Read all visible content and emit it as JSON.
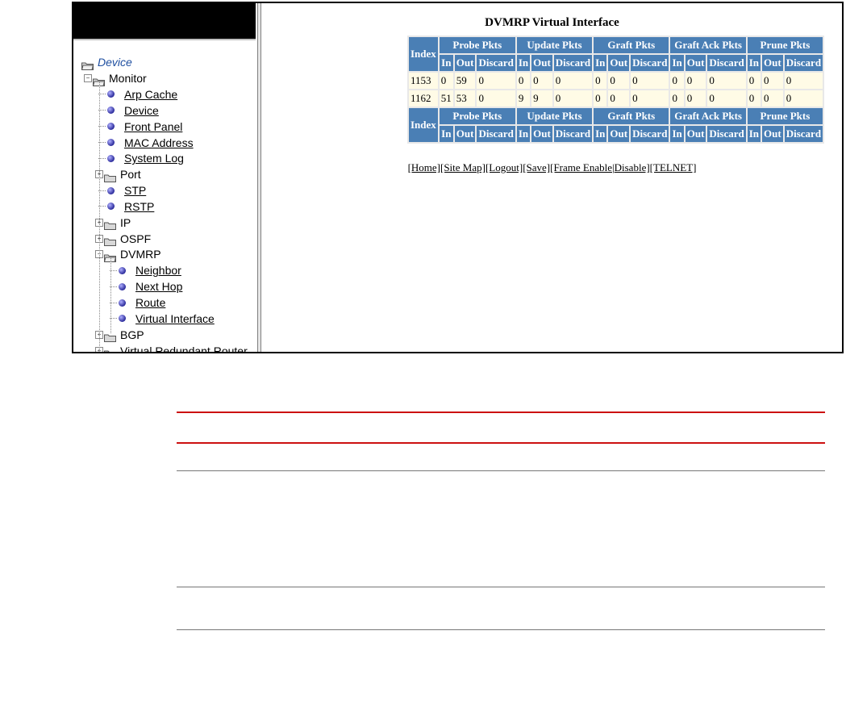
{
  "tree": {
    "device": "Device",
    "monitor": "Monitor",
    "monitor_items": [
      "Arp Cache",
      "Device",
      "Front Panel",
      "MAC Address",
      "System Log"
    ],
    "port": "Port",
    "stp": "STP",
    "rstp": "RSTP",
    "ip": "IP",
    "ospf": "OSPF",
    "dvmrp": "DVMRP",
    "dvmrp_items": [
      "Neighbor",
      "Next Hop",
      "Route",
      "Virtual Interface"
    ],
    "bgp": "BGP",
    "vrr": "Virtual Redundant Router"
  },
  "content": {
    "title": "DVMRP Virtual Interface",
    "index_label": "Index",
    "groups": [
      "Probe Pkts",
      "Update Pkts",
      "Graft Pkts",
      "Graft Ack Pkts",
      "Prune Pkts"
    ],
    "subheads": [
      "In",
      "Out",
      "Discard"
    ],
    "rows": [
      {
        "index": "1153",
        "values": [
          "0",
          "59",
          "0",
          "0",
          "0",
          "0",
          "0",
          "0",
          "0",
          "0",
          "0",
          "0",
          "0",
          "0",
          "0"
        ]
      },
      {
        "index": "1162",
        "values": [
          "51",
          "53",
          "0",
          "9",
          "9",
          "0",
          "0",
          "0",
          "0",
          "0",
          "0",
          "0",
          "0",
          "0",
          "0"
        ]
      }
    ],
    "links": [
      "[Home]",
      "[Site Map]",
      "[Logout]",
      "[Save]",
      "[Frame Enable",
      "|",
      "Disable]",
      "[TELNET]"
    ]
  },
  "colors": {
    "header_bg": "#4a7fb5",
    "cell_bg": "#fffbe6",
    "red_rule": "#cc1111"
  }
}
